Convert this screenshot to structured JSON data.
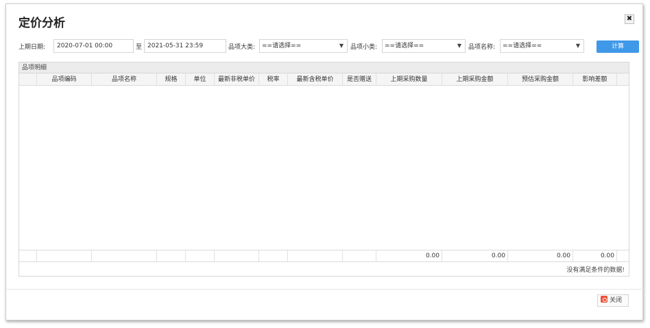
{
  "dialog": {
    "title": "定价分析",
    "close_symbol": "✖"
  },
  "filters": {
    "last_period_label": "上期日期:",
    "start_date": "2020-07-01 00:00",
    "to_label": "至",
    "end_date": "2021-05-31 23:59",
    "category_major_label": "品项大类:",
    "category_major_value": "==请选择==",
    "category_minor_label": "品项小类:",
    "category_minor_value": "==请选择==",
    "item_name_label": "品项名称:",
    "item_name_value": "==请选择==",
    "calc_button": "计算"
  },
  "grid": {
    "panel_title": "品项明细",
    "columns": [
      "",
      "品项编码",
      "品项名称",
      "规格",
      "单位",
      "最新非税单价",
      "税率",
      "最新含税单价",
      "是否赠送",
      "上期采购数量",
      "上期采购金额",
      "预估采购金额",
      "影响差额",
      ""
    ],
    "totals": [
      "",
      "",
      "",
      "",
      "",
      "",
      "",
      "",
      "",
      "0.00",
      "0.00",
      "0.00",
      "0.00",
      ""
    ],
    "empty_message": "没有满足条件的数据!"
  },
  "footer": {
    "close_button": "关闭"
  }
}
